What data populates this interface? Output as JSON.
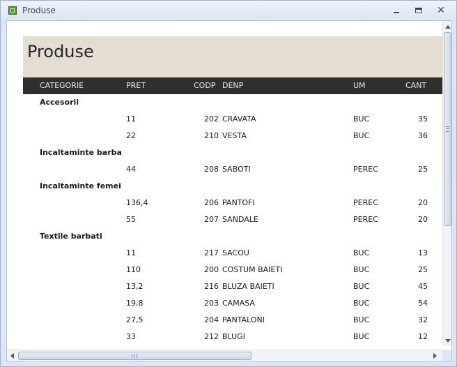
{
  "window": {
    "title": "Produse"
  },
  "report": {
    "title": "Produse",
    "columns": {
      "categorie": "CATEGORIE",
      "pret": "PRET",
      "codp": "CODP",
      "denp": "DENP",
      "um": "UM",
      "cant": "CANT"
    },
    "groups": [
      {
        "category": "Accesorii",
        "rows": [
          {
            "pret": "11",
            "codp": "202",
            "denp": "CRAVATA",
            "um": "BUC",
            "cant": "35"
          },
          {
            "pret": "22",
            "codp": "210",
            "denp": "VESTA",
            "um": "BUC",
            "cant": "36"
          }
        ]
      },
      {
        "category": "Incaltaminte barbati",
        "rows": [
          {
            "pret": "44",
            "codp": "208",
            "denp": "SABOTI",
            "um": "PEREC",
            "cant": "25"
          }
        ]
      },
      {
        "category": "Incaltaminte femei",
        "rows": [
          {
            "pret": "136,4",
            "codp": "206",
            "denp": "PANTOFI",
            "um": "PEREC",
            "cant": "20"
          },
          {
            "pret": "55",
            "codp": "207",
            "denp": "SANDALE",
            "um": "PEREC",
            "cant": "20"
          }
        ]
      },
      {
        "category": "Textile barbati",
        "rows": [
          {
            "pret": "11",
            "codp": "217",
            "denp": "SACOU",
            "um": "BUC",
            "cant": "13"
          },
          {
            "pret": "110",
            "codp": "200",
            "denp": "COSTUM BAIETI",
            "um": "BUC",
            "cant": "25"
          },
          {
            "pret": "13,2",
            "codp": "216",
            "denp": "BLUZA BAIETI",
            "um": "BUC",
            "cant": "45"
          },
          {
            "pret": "19,8",
            "codp": "203",
            "denp": "CAMASA",
            "um": "BUC",
            "cant": "54"
          },
          {
            "pret": "27,5",
            "codp": "204",
            "denp": "PANTALONI",
            "um": "BUC",
            "cant": "32"
          },
          {
            "pret": "33",
            "codp": "212",
            "denp": "BLUGI",
            "um": "BUC",
            "cant": "12"
          }
        ]
      }
    ]
  },
  "colors": {
    "header_band": "#e3ddd2",
    "column_bar": "#2f2f2f",
    "category_text": "#5a3c7a"
  }
}
